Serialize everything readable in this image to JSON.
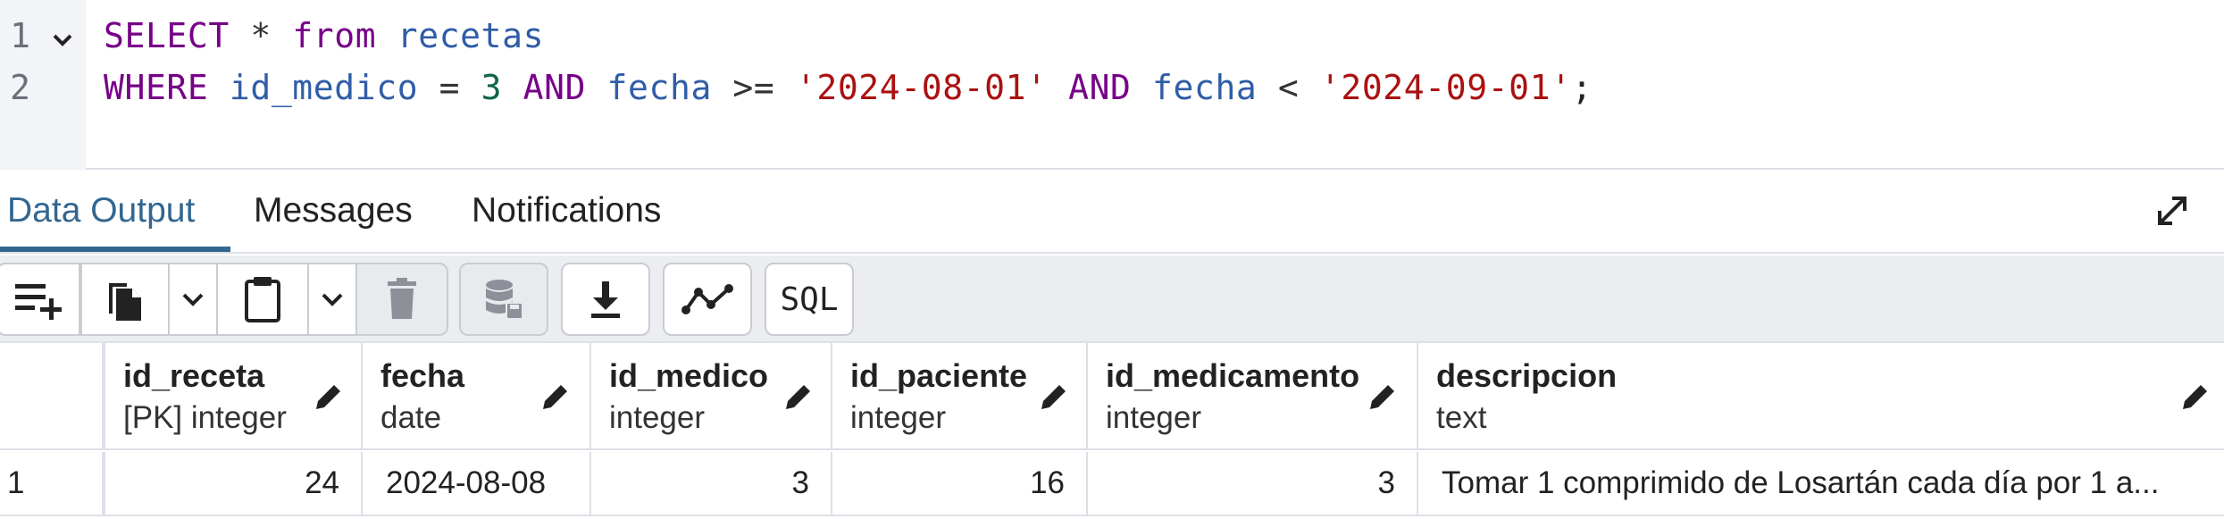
{
  "editor": {
    "line_numbers": [
      "1",
      "2"
    ],
    "line1": {
      "kw1": "SELECT",
      "star": "*",
      "kw2": "from",
      "table": "recetas"
    },
    "line2": {
      "kw_where": "WHERE",
      "col1": "id_medico",
      "eq": "=",
      "val1": "3",
      "and1": "AND",
      "col2": "fecha",
      "ge": ">=",
      "date1": "'2024-08-01'",
      "and2": "AND",
      "col3": "fecha",
      "lt": "<",
      "date2": "'2024-09-01'",
      "semi": ";"
    }
  },
  "tabs": {
    "items": [
      "Data Output",
      "Messages",
      "Notifications"
    ],
    "active": "Data Output"
  },
  "toolbar": {
    "sql_label": "SQL",
    "icons": [
      "add-row-icon",
      "copy-icon",
      "chevron-down-icon",
      "paste-icon",
      "chevron-down-icon",
      "delete-icon",
      "save-data-icon",
      "download-icon",
      "graph-icon",
      "sql-icon"
    ]
  },
  "grid": {
    "columns": [
      {
        "name": "id_receta",
        "type": "[PK] integer"
      },
      {
        "name": "fecha",
        "type": "date"
      },
      {
        "name": "id_medico",
        "type": "integer"
      },
      {
        "name": "id_paciente",
        "type": "integer"
      },
      {
        "name": "id_medicamento",
        "type": "integer"
      },
      {
        "name": "descripcion",
        "type": "text"
      }
    ],
    "rows": [
      {
        "num": "1",
        "cells": [
          "24",
          "2024-08-08",
          "3",
          "16",
          "3",
          "Tomar 1 comprimido de Losartán cada día por 1 a..."
        ]
      }
    ]
  },
  "colors": {
    "accent": "#326690",
    "keyword": "#770088",
    "identifier": "#2f5da8",
    "number": "#116644",
    "string": "#aa1111"
  }
}
